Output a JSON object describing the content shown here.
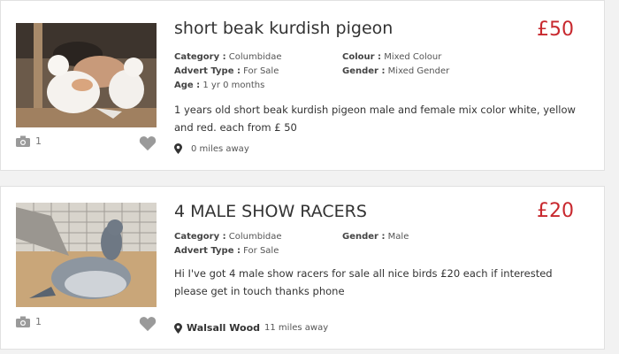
{
  "listings": [
    {
      "title": "short beak kurdish pigeon",
      "price": "£50",
      "photo_count": "1",
      "attributes": {
        "category_label": "Category :",
        "category_value": "Columbidae",
        "colour_label": "Colour :",
        "colour_value": "Mixed Colour",
        "advert_type_label": "Advert Type :",
        "advert_type_value": "For Sale",
        "gender_label": "Gender :",
        "gender_value": "Mixed Gender",
        "age_label": "Age :",
        "age_value": "1 yr 0 months"
      },
      "description": "1 years old short beak kurdish pigeon male and female mix color white, yellow and red. each  from £ 50",
      "location_name": "",
      "distance": "0 miles away"
    },
    {
      "title": "4 MALE SHOW RACERS",
      "price": "£20",
      "photo_count": "1",
      "attributes": {
        "category_label": "Category :",
        "category_value": "Columbidae",
        "gender_label": "Gender :",
        "gender_value": "Male",
        "advert_type_label": "Advert Type :",
        "advert_type_value": "For Sale"
      },
      "description": "Hi I've got 4 male show racers for sale all nice birds £20 each if interested please get in touch thanks phone",
      "location_name": "Walsall Wood",
      "distance": "11 miles away"
    }
  ],
  "colors": {
    "price": "#c8282e",
    "icon": "#9a9a9a"
  }
}
